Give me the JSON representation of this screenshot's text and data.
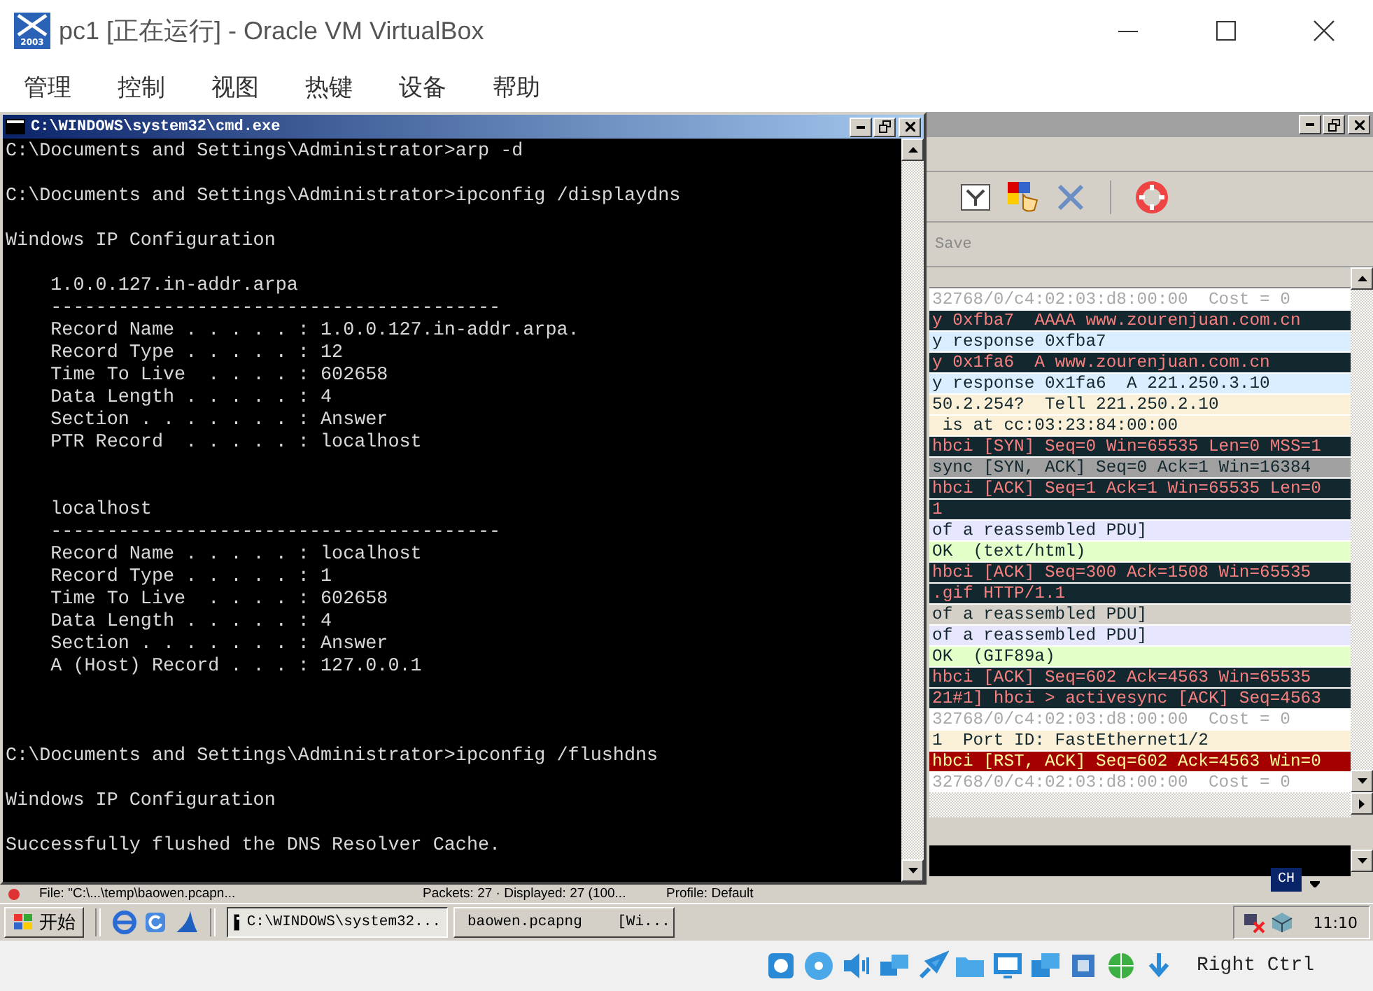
{
  "window": {
    "title": "pc1 [正在运行] - Oracle VM VirtualBox",
    "icon_label": "2003"
  },
  "menu": [
    "管理",
    "控制",
    "视图",
    "热键",
    "设备",
    "帮助"
  ],
  "cmd_window": {
    "title": "C:\\WINDOWS\\system32\\cmd.exe",
    "lines": [
      {
        "kind": "text",
        "text": "C:\\Documents and Settings\\Administrator>arp -d"
      },
      {
        "kind": "blank"
      },
      {
        "kind": "text",
        "text": "C:\\Documents and Settings\\Administrator>ipconfig /displaydns"
      },
      {
        "kind": "blank"
      },
      {
        "kind": "text",
        "text": "Windows IP Configuration"
      },
      {
        "kind": "blank"
      },
      {
        "kind": "text",
        "text": "    1.0.0.127.in-addr.arpa"
      },
      {
        "kind": "text",
        "text": "    ----------------------------------------"
      },
      {
        "kind": "text",
        "text": "    Record Name . . . . . : 1.0.0.127.in-addr.arpa."
      },
      {
        "kind": "text",
        "text": "    Record Type . . . . . : 12"
      },
      {
        "kind": "text",
        "text": "    Time To Live  . . . . : 602658"
      },
      {
        "kind": "text",
        "text": "    Data Length . . . . . : 4"
      },
      {
        "kind": "text",
        "text": "    Section . . . . . . . : Answer"
      },
      {
        "kind": "text",
        "text": "    PTR Record  . . . . . : localhost"
      },
      {
        "kind": "blank"
      },
      {
        "kind": "blank"
      },
      {
        "kind": "text",
        "text": "    localhost"
      },
      {
        "kind": "text",
        "text": "    ----------------------------------------"
      },
      {
        "kind": "text",
        "text": "    Record Name . . . . . : localhost"
      },
      {
        "kind": "text",
        "text": "    Record Type . . . . . : 1"
      },
      {
        "kind": "text",
        "text": "    Time To Live  . . . . : 602658"
      },
      {
        "kind": "text",
        "text": "    Data Length . . . . . : 4"
      },
      {
        "kind": "text",
        "text": "    Section . . . . . . . : Answer"
      },
      {
        "kind": "text",
        "text": "    A (Host) Record . . . : 127.0.0.1"
      },
      {
        "kind": "blank"
      },
      {
        "kind": "blank"
      },
      {
        "kind": "blank"
      },
      {
        "kind": "text",
        "text": "C:\\Documents and Settings\\Administrator>ipconfig /flushdns"
      },
      {
        "kind": "blank"
      },
      {
        "kind": "text",
        "text": "Windows IP Configuration"
      },
      {
        "kind": "blank"
      },
      {
        "kind": "text",
        "text": "Successfully flushed the DNS Resolver Cache."
      }
    ]
  },
  "wireshark": {
    "filter_button": "Save",
    "packets": [
      {
        "kind": "stp",
        "text": "32768/0/c4:02:03:d8:00:00  Cost = 0"
      },
      {
        "kind": "dark",
        "text": "y 0xfba7  AAAA www.zourenjuan.com.cn"
      },
      {
        "kind": "dns",
        "text": "y response 0xfba7"
      },
      {
        "kind": "dark",
        "text": "y 0x1fa6  A www.zourenjuan.com.cn"
      },
      {
        "kind": "dns",
        "text": "y response 0x1fa6  A 221.250.3.10"
      },
      {
        "kind": "arp",
        "text": "50.2.254?  Tell 221.250.2.10"
      },
      {
        "kind": "arp",
        "text": " is at cc:03:23:84:00:00"
      },
      {
        "kind": "dark",
        "text": "hbci [SYN] Seq=0 Win=65535 Len=0 MSS=1"
      },
      {
        "kind": "syn",
        "text": "sync [SYN, ACK] Seq=0 Ack=1 Win=16384"
      },
      {
        "kind": "dark",
        "text": "hbci [ACK] Seq=1 Ack=1 Win=65535 Len=0"
      },
      {
        "kind": "dark",
        "text": "1"
      },
      {
        "kind": "pdu",
        "text": "of a reassembled PDU]"
      },
      {
        "kind": "http",
        "text": "OK  (text/html)"
      },
      {
        "kind": "dark",
        "text": "hbci [ACK] Seq=300 Ack=1508 Win=65535"
      },
      {
        "kind": "dark",
        "text": ".gif HTTP/1.1"
      },
      {
        "kind": "grey",
        "text": "of a reassembled PDU]"
      },
      {
        "kind": "pdu",
        "text": "of a reassembled PDU]"
      },
      {
        "kind": "http",
        "text": "OK  (GIF89a)"
      },
      {
        "kind": "dark",
        "text": "hbci [ACK] Seq=602 Ack=4563 Win=65535"
      },
      {
        "kind": "dark",
        "text": "21#1] hbci > activesync [ACK] Seq=4563"
      },
      {
        "kind": "stp",
        "text": "32768/0/c4:02:03:d8:00:00  Cost = 0"
      },
      {
        "kind": "arp",
        "text": "1  Port ID: FastEthernet1/2"
      },
      {
        "kind": "rst",
        "text": "hbci [RST, ACK] Seq=602 Ack=4563 Win=0"
      },
      {
        "kind": "stp",
        "text": "32768/0/c4:02:03:d8:00:00  Cost = 0"
      }
    ],
    "status": [
      "File: \"C:\\...\\temp\\baowen.pcapn...",
      "Packets: 27 · Displayed: 27 (100...",
      "Profile: Default"
    ]
  },
  "language_indicator": "CH",
  "taskbar": {
    "start": "开始",
    "tasks": [
      {
        "label": "C:\\WINDOWS\\system32...",
        "selected": true
      },
      {
        "label": "baowen.pcapng    [Wi...",
        "selected": false
      }
    ],
    "clock": "11:10"
  },
  "status_bar": {
    "host_key": "Right Ctrl"
  }
}
